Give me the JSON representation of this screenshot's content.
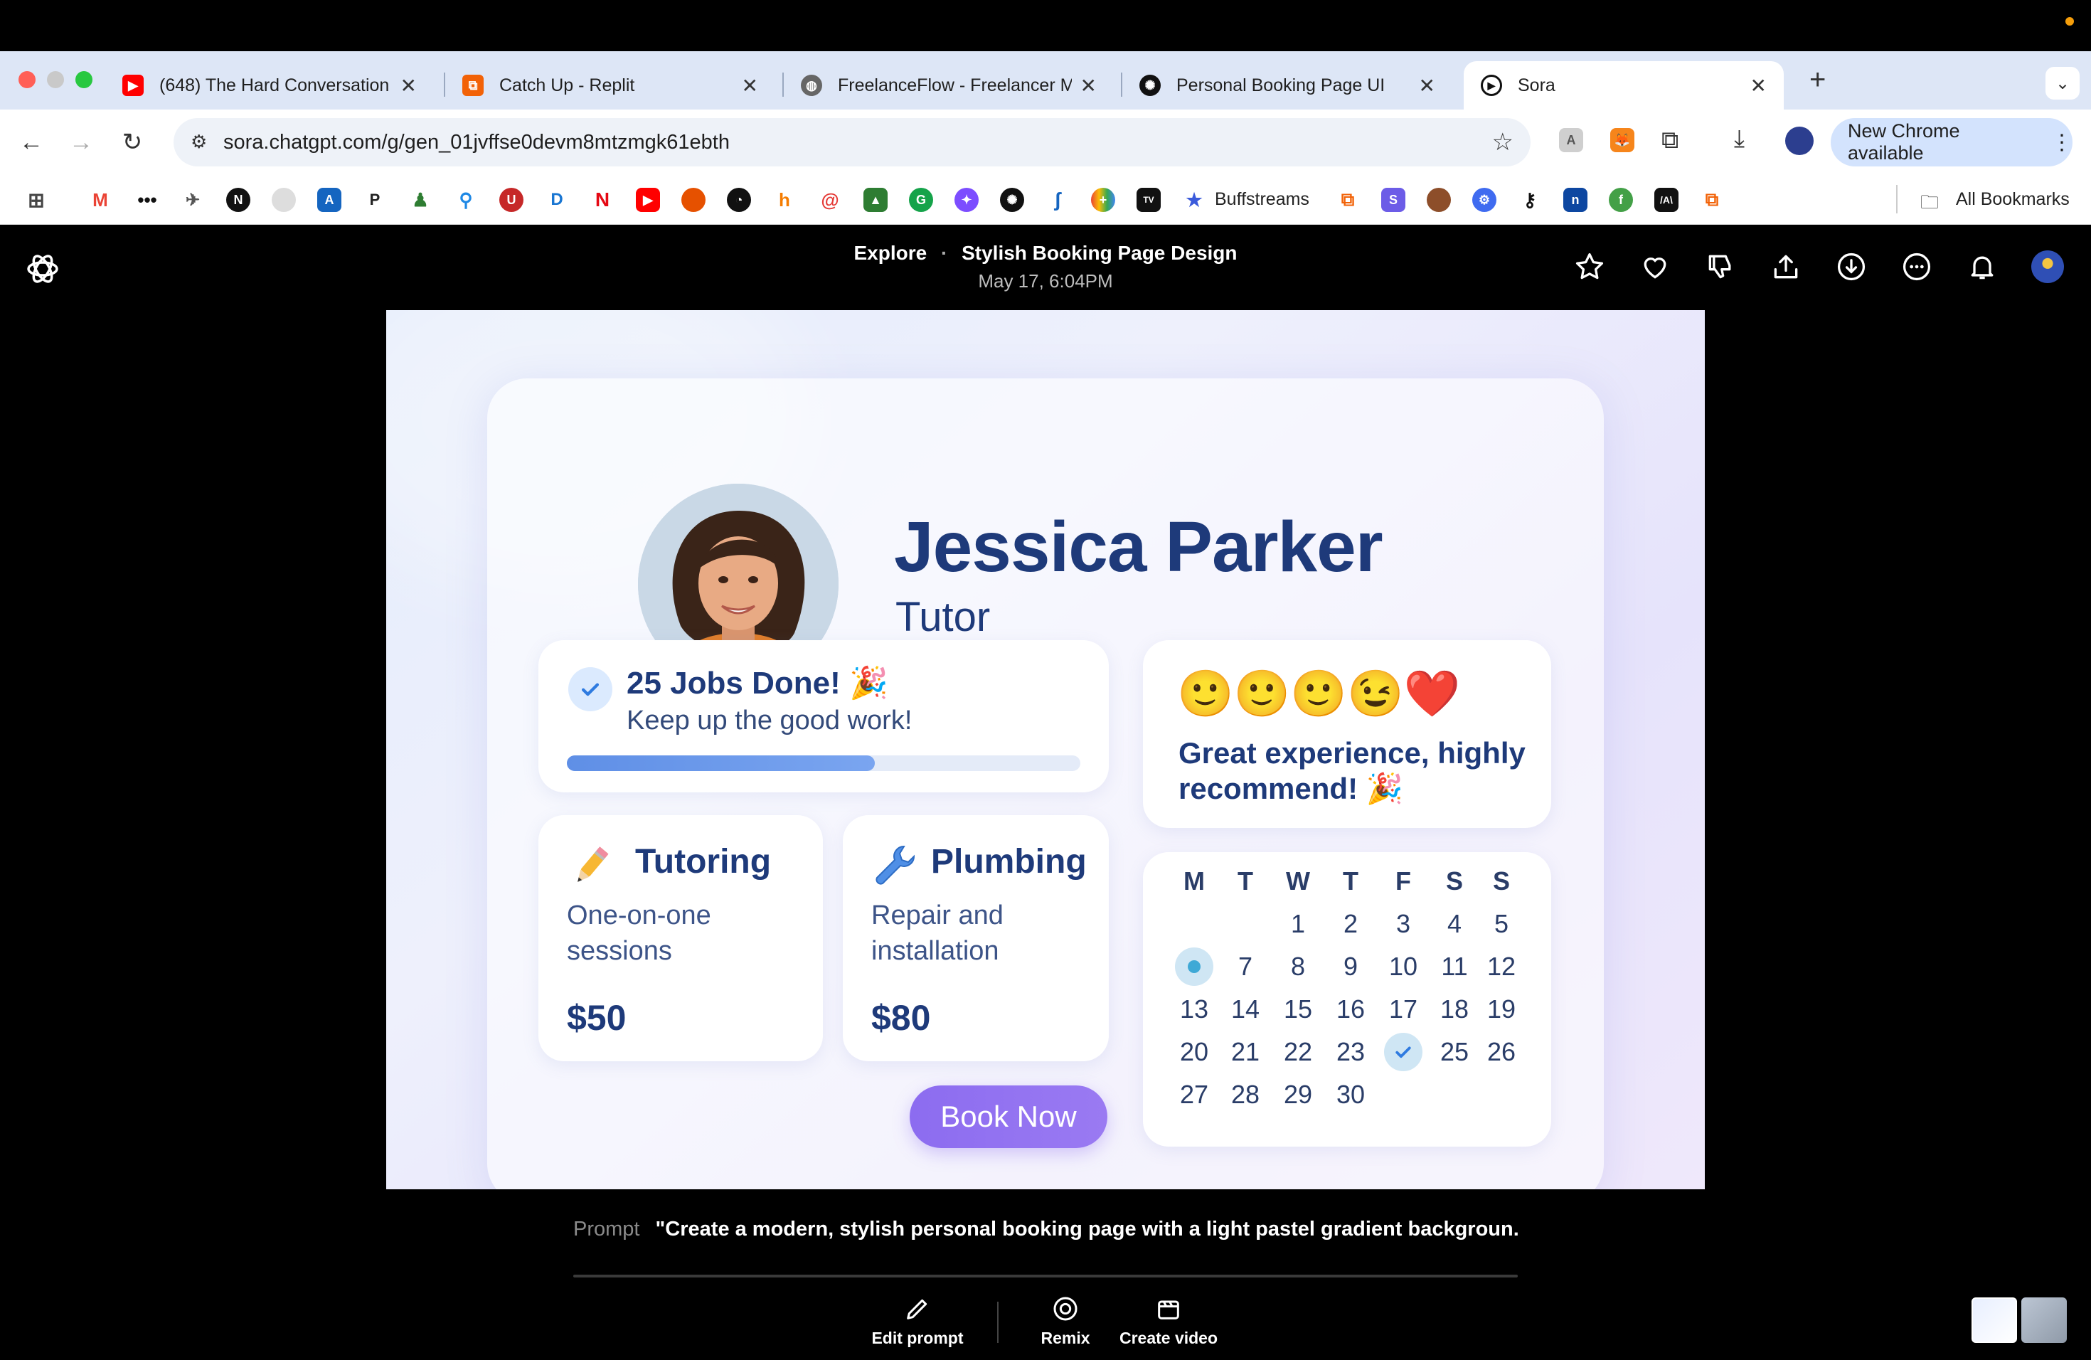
{
  "browser": {
    "tabs": [
      {
        "title": "(648) The Hard Conversation",
        "icon": "youtube-icon",
        "color": "#ff0000"
      },
      {
        "title": "Catch Up - Replit",
        "icon": "replit-icon",
        "color": "#f26207"
      },
      {
        "title": "FreelanceFlow - Freelancer M",
        "icon": "globe-icon",
        "color": "#555555"
      },
      {
        "title": "Personal Booking Page UI",
        "icon": "openai-icon",
        "color": "#111111"
      },
      {
        "title": "Sora",
        "icon": "sora-icon",
        "color": "#111111"
      }
    ],
    "active_tab": 4,
    "url": "sora.chatgpt.com/g/gen_01jvffse0devm8mtzmgk61ebth",
    "update_button": "New Chrome available",
    "bookmarks_text": "Buffstreams",
    "all_bookmarks": "All Bookmarks"
  },
  "sora": {
    "breadcrumb": "Explore",
    "separator": "·",
    "title": "Stylish Booking Page Design",
    "date": "May 17, 6:04PM",
    "prompt_label": "Prompt",
    "prompt_text": "\"Create a modern, stylish personal booking page with a light pastel gradient backgroun...",
    "actions": [
      {
        "label": "Edit prompt",
        "icon": "pencil-icon"
      },
      {
        "label": "Remix",
        "icon": "remix-icon"
      },
      {
        "label": "Create video",
        "icon": "clapper-icon"
      }
    ]
  },
  "booking": {
    "name": "Jessica Parker",
    "role": "Tutor",
    "jobs_title": "25 Jobs Done! 🎉",
    "jobs_sub": "Keep up the good work!",
    "progress": 0.6,
    "review_emojis": "🙂🙂🙂😉❤️",
    "review_text": "Great experience, highly recommend! 🎉",
    "services": [
      {
        "title": "Tutoring",
        "desc": "One-on-one sessions",
        "price": "$50",
        "icon": "pencil-icon"
      },
      {
        "title": "Plumbing",
        "desc": "Repair and installation",
        "price": "$80",
        "icon": "wrench-icon"
      }
    ],
    "book_button": "Book Now",
    "calendar": {
      "weekdays": [
        "M",
        "T",
        "W",
        "T",
        "F",
        "S",
        "S"
      ],
      "rows": [
        [
          "",
          "",
          "1",
          "2",
          "3",
          "4",
          "5"
        ],
        [
          "•",
          "7",
          "8",
          "9",
          "10",
          "11",
          "12"
        ],
        [
          "13",
          "14",
          "15",
          "16",
          "17",
          "18",
          "19"
        ],
        [
          "20",
          "21",
          "22",
          "23",
          "✓",
          "25",
          "26"
        ],
        [
          "27",
          "28",
          "29",
          "30",
          "",
          "",
          ""
        ]
      ]
    }
  },
  "colors": {
    "accent": "#8c6cf0",
    "heading": "#1e3a7a",
    "progress": "#5f8fe6"
  }
}
